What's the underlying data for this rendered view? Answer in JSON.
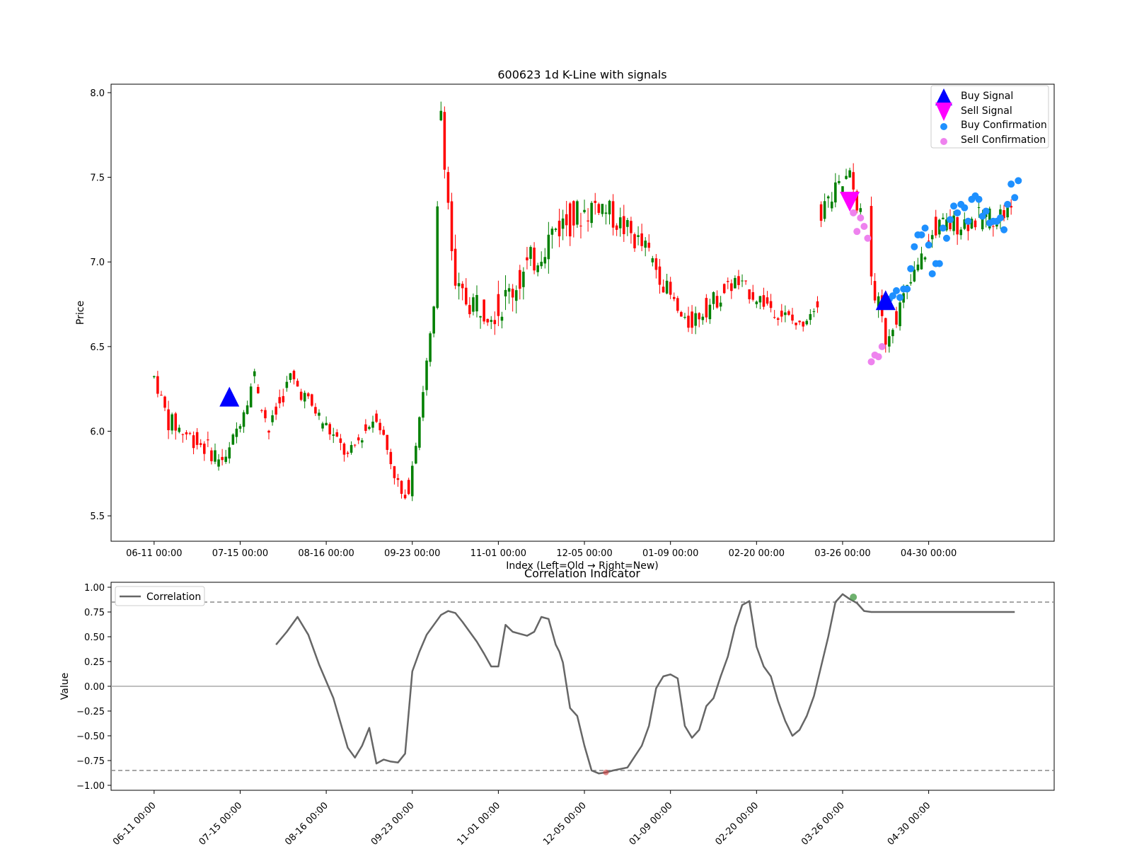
{
  "chart_data": [
    {
      "type": "candlestick",
      "title": "600623 1d K-Line with signals",
      "xlabel": "Index (Left=Old → Right=New)",
      "ylabel": "Price",
      "ylim": [
        5.35,
        8.05
      ],
      "yticks": [
        "5.5",
        "6.0",
        "6.5",
        "7.0",
        "7.5",
        "8.0"
      ],
      "xticks": [
        "06-11 00:00",
        "07-15 00:00",
        "08-16 00:00",
        "09-23 00:00",
        "11-01 00:00",
        "12-05 00:00",
        "01-09 00:00",
        "02-20 00:00",
        "03-26 00:00",
        "04-30 00:00"
      ],
      "xtick_index": [
        0,
        24,
        48,
        72,
        96,
        120,
        144,
        168,
        192,
        216
      ],
      "index_range": [
        -12,
        251
      ],
      "legend": {
        "placement": "upper right",
        "entries": [
          "Buy Signal",
          "Sell Signal",
          "Buy Confirmation",
          "Sell Confirmation"
        ]
      },
      "up_color": "#008000",
      "down_color": "#ff0000",
      "trend_segments": [
        {
          "from": 0,
          "to": 4,
          "s": 6.32,
          "e": 6.06,
          "n": 0.04
        },
        {
          "from": 4,
          "to": 20,
          "s": 6.06,
          "e": 5.82,
          "n": 0.06
        },
        {
          "from": 20,
          "to": 28,
          "s": 5.82,
          "e": 6.33,
          "n": 0.05
        },
        {
          "from": 28,
          "to": 32,
          "s": 6.33,
          "e": 6.0,
          "n": 0.05
        },
        {
          "from": 32,
          "to": 38,
          "s": 6.0,
          "e": 6.32,
          "n": 0.05
        },
        {
          "from": 38,
          "to": 54,
          "s": 6.32,
          "e": 5.85,
          "n": 0.05
        },
        {
          "from": 54,
          "to": 62,
          "s": 5.85,
          "e": 6.1,
          "n": 0.04
        },
        {
          "from": 62,
          "to": 70,
          "s": 6.1,
          "e": 5.55,
          "n": 0.05
        },
        {
          "from": 70,
          "to": 74,
          "s": 5.55,
          "e": 6.1,
          "n": 0.06
        },
        {
          "from": 74,
          "to": 78,
          "s": 6.1,
          "e": 6.7,
          "n": 0.05
        },
        {
          "from": 78,
          "to": 80,
          "s": 6.7,
          "e": 7.9,
          "n": 0.05
        },
        {
          "from": 80,
          "to": 84,
          "s": 7.9,
          "e": 6.8,
          "n": 0.08
        },
        {
          "from": 84,
          "to": 96,
          "s": 6.8,
          "e": 6.72,
          "n": 0.1
        },
        {
          "from": 96,
          "to": 112,
          "s": 6.72,
          "e": 7.2,
          "n": 0.1
        },
        {
          "from": 112,
          "to": 124,
          "s": 7.2,
          "e": 7.35,
          "n": 0.1
        },
        {
          "from": 124,
          "to": 138,
          "s": 7.35,
          "e": 7.05,
          "n": 0.08
        },
        {
          "from": 138,
          "to": 148,
          "s": 7.05,
          "e": 6.62,
          "n": 0.06
        },
        {
          "from": 148,
          "to": 162,
          "s": 6.62,
          "e": 6.88,
          "n": 0.06
        },
        {
          "from": 162,
          "to": 180,
          "s": 6.88,
          "e": 6.62,
          "n": 0.05
        },
        {
          "from": 180,
          "to": 186,
          "s": 6.62,
          "e": 6.8,
          "n": 0.04
        }
      ],
      "trend_segments_2": [
        {
          "from": 186,
          "to": 194,
          "s": 7.3,
          "e": 7.5,
          "n": 0.08
        },
        {
          "from": 194,
          "to": 198,
          "s": 7.5,
          "e": 7.2,
          "n": 0.06
        },
        {
          "from": 200,
          "to": 204,
          "s": 6.9,
          "e": 6.55,
          "n": 0.08
        },
        {
          "from": 204,
          "to": 218,
          "s": 6.55,
          "e": 7.2,
          "n": 0.06
        },
        {
          "from": 218,
          "to": 240,
          "s": 7.2,
          "e": 7.3,
          "n": 0.07
        }
      ],
      "buy_signals": [
        {
          "x": 21,
          "y": 6.2
        },
        {
          "x": 204,
          "y": 6.77
        }
      ],
      "sell_signals": [
        {
          "x": 194,
          "y": 7.36
        }
      ],
      "buy_confirmations": [
        [
          205,
          6.78
        ],
        [
          206,
          6.8
        ],
        [
          207,
          6.83
        ],
        [
          208,
          6.79
        ],
        [
          209,
          6.84
        ],
        [
          210,
          6.84
        ],
        [
          211,
          6.96
        ],
        [
          212,
          7.09
        ],
        [
          213,
          7.16
        ],
        [
          214,
          7.16
        ],
        [
          215,
          7.2
        ],
        [
          216,
          7.1
        ],
        [
          217,
          6.93
        ],
        [
          218,
          6.99
        ],
        [
          219,
          6.99
        ],
        [
          220,
          7.2
        ],
        [
          221,
          7.14
        ],
        [
          222,
          7.25
        ],
        [
          223,
          7.33
        ],
        [
          224,
          7.29
        ],
        [
          225,
          7.34
        ],
        [
          226,
          7.32
        ],
        [
          227,
          7.24
        ],
        [
          228,
          7.37
        ],
        [
          229,
          7.39
        ],
        [
          230,
          7.37
        ],
        [
          231,
          7.27
        ],
        [
          232,
          7.3
        ],
        [
          233,
          7.23
        ],
        [
          234,
          7.24
        ],
        [
          235,
          7.24
        ],
        [
          236,
          7.26
        ],
        [
          237,
          7.19
        ],
        [
          238,
          7.34
        ],
        [
          239,
          7.46
        ],
        [
          240,
          7.38
        ],
        [
          241,
          7.48
        ]
      ],
      "sell_confirmations": [
        [
          195,
          7.29
        ],
        [
          196,
          7.18
        ],
        [
          197,
          7.26
        ],
        [
          198,
          7.21
        ],
        [
          199,
          7.14
        ],
        [
          200,
          6.41
        ],
        [
          201,
          6.45
        ],
        [
          202,
          6.44
        ],
        [
          203,
          6.5
        ]
      ]
    },
    {
      "type": "line",
      "title": "Correlation Indicator",
      "ylabel": "Value",
      "ylim": [
        -1.05,
        1.05
      ],
      "yticks": [
        "−1.00",
        "−0.75",
        "−0.50",
        "−0.25",
        "0.00",
        "0.25",
        "0.50",
        "0.75",
        "1.00"
      ],
      "xticks": [
        "06-11 00:00",
        "07-15 00:00",
        "08-16 00:00",
        "09-23 00:00",
        "11-01 00:00",
        "12-05 00:00",
        "01-09 00:00",
        "02-20 00:00",
        "03-26 00:00",
        "04-30 00:00"
      ],
      "xtick_index": [
        0,
        24,
        48,
        72,
        96,
        120,
        144,
        168,
        192,
        216
      ],
      "thresholds": [
        0.85,
        -0.85
      ],
      "line_color": "#666666",
      "threshold_color": "#888888",
      "zero_color": "#aaaaaa",
      "legend": {
        "placement": "upper left",
        "entries": [
          "Correlation"
        ]
      },
      "series": [
        {
          "name": "Correlation",
          "x": [
            34,
            37,
            40,
            43,
            46,
            50,
            54,
            56,
            58,
            60,
            62,
            64,
            66,
            68,
            70,
            72,
            74,
            76,
            78,
            80,
            82,
            84,
            86,
            88,
            90,
            92,
            94,
            96,
            98,
            100,
            102,
            104,
            106,
            108,
            110,
            111,
            112,
            113,
            114,
            116,
            118,
            120,
            122,
            124,
            126,
            128,
            132,
            136,
            138,
            140,
            142,
            144,
            146,
            148,
            150,
            152,
            154,
            156,
            158,
            160,
            162,
            164,
            166,
            168,
            170,
            172,
            174,
            176,
            178,
            180,
            182,
            184,
            186,
            188,
            190,
            192,
            194,
            196,
            198,
            200,
            202,
            204,
            206,
            208,
            210,
            212,
            214,
            216,
            218,
            220,
            222,
            224,
            226,
            228,
            230,
            232,
            234,
            236,
            238,
            240
          ],
          "y": [
            0.42,
            0.55,
            0.7,
            0.52,
            0.22,
            -0.12,
            -0.62,
            -0.72,
            -0.6,
            -0.42,
            -0.78,
            -0.74,
            -0.76,
            -0.77,
            -0.68,
            0.15,
            0.35,
            0.52,
            0.62,
            0.72,
            0.76,
            0.74,
            0.65,
            0.55,
            0.45,
            0.33,
            0.2,
            0.2,
            0.62,
            0.55,
            0.53,
            0.51,
            0.55,
            0.7,
            0.68,
            0.55,
            0.42,
            0.35,
            0.24,
            -0.22,
            -0.3,
            -0.6,
            -0.85,
            -0.88,
            -0.87,
            -0.85,
            -0.82,
            -0.6,
            -0.4,
            -0.02,
            0.1,
            0.12,
            0.08,
            -0.4,
            -0.52,
            -0.44,
            -0.2,
            -0.12,
            0.1,
            0.3,
            0.6,
            0.82,
            0.86,
            0.4,
            0.2,
            0.1,
            -0.15,
            -0.35,
            -0.5,
            -0.44,
            -0.3,
            -0.1,
            0.2,
            0.5,
            0.85,
            0.93,
            0.88,
            0.84,
            0.76,
            0.75,
            0.75,
            0.75,
            0.75,
            0.75,
            0.75,
            0.75,
            0.75,
            0.75,
            0.75,
            0.75,
            0.75,
            0.75,
            0.75,
            0.75,
            0.75,
            0.75,
            0.75,
            0.75,
            0.75,
            0.75
          ]
        }
      ]
    }
  ]
}
